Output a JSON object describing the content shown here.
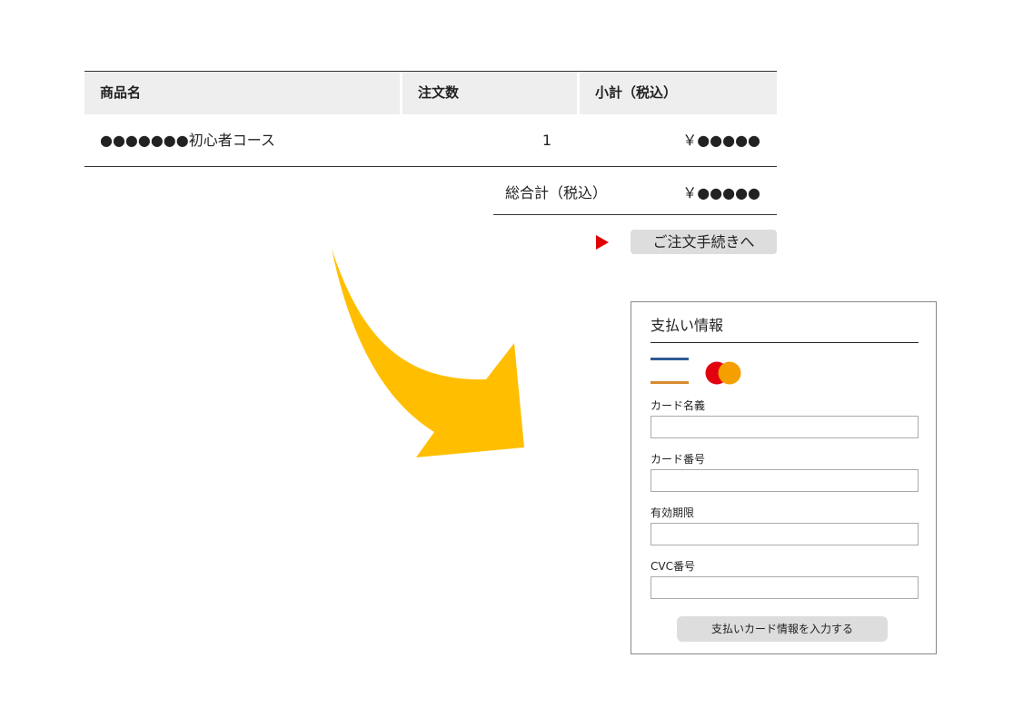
{
  "order_table": {
    "headers": [
      "商品名",
      "注文数",
      "小計（税込）"
    ],
    "rows": [
      {
        "name": "●●●●●●●初心者コース",
        "qty": "1",
        "subtotal": "￥●●●●●"
      }
    ],
    "total_label": "総合計（税込）",
    "total_value": "￥●●●●●"
  },
  "checkout_button": "ご注文手続きへ",
  "payment": {
    "title": "支払い情報",
    "icons": [
      "credit-card-icon",
      "mastercard-icon"
    ],
    "fields": [
      {
        "label": "カード名義",
        "value": ""
      },
      {
        "label": "カード番号",
        "value": ""
      },
      {
        "label": "有効期限",
        "value": ""
      },
      {
        "label": "CVC番号",
        "value": ""
      }
    ],
    "submit_label": "支払いカード情報を入力する"
  },
  "colors": {
    "header_bg": "#eeeeee",
    "arrow": "#ffbf00",
    "play_icon": "#e00000",
    "button_bg": "#dddddd",
    "card_stripe_blue": "#2f5a96",
    "card_stripe_orange": "#d68b2d",
    "mc_red": "#e3000f",
    "mc_orange": "#f5a000"
  }
}
